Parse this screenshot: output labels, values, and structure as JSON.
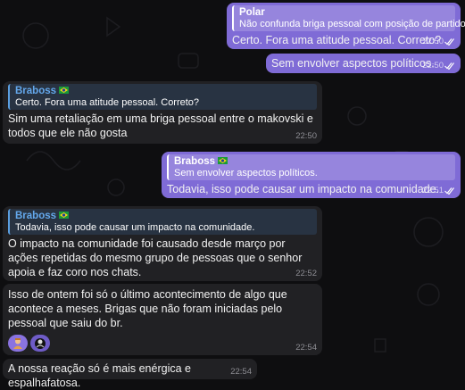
{
  "messages": [
    {
      "reply_name": "Polar",
      "reply_text": "Não confunda briga pessoal com posição de partido.",
      "text": "Certo. Fora uma atitude pessoal. Correto?",
      "time": "22:50"
    },
    {
      "text": "Sem envolver aspectos políticos.",
      "time": "22:50"
    },
    {
      "reply_name": "Braboss",
      "reply_text": "Certo. Fora uma atitude pessoal. Correto?",
      "text": "Sim uma retaliação em uma briga pessoal entre o makovski e todos que ele não gosta",
      "time": "22:50"
    },
    {
      "reply_name": "Braboss",
      "reply_text": "Sem envolver aspectos políticos.",
      "text": "Todavia, isso pode causar um impacto na comunidade.",
      "time": "22:51"
    },
    {
      "reply_name": "Braboss",
      "reply_text": "Todavia, isso pode causar um impacto na comunidade.",
      "text": "O impacto na comunidade foi causado desde março por ações repetidas do mesmo grupo de pessoas que o senhor apoia e faz coro nos chats.",
      "time": "22:52"
    },
    {
      "text": "Isso de ontem foi só o último acontecimento de algo que acontece a meses. Brigas que não foram iniciadas pelo pessoal que saiu do br.",
      "time": "22:54"
    },
    {
      "text": "A nossa reação só é mais enérgica e espalhafatosa.",
      "time": "22:54"
    }
  ],
  "reactions": [
    {
      "icon": "person-avatar-icon"
    },
    {
      "icon": "dark-avatar-icon"
    }
  ],
  "colors": {
    "outgoing_bubble": "#7f6bd6",
    "incoming_bubble": "#212124",
    "reply_name_in": "#64a8ec",
    "background": "#0e0e10"
  }
}
